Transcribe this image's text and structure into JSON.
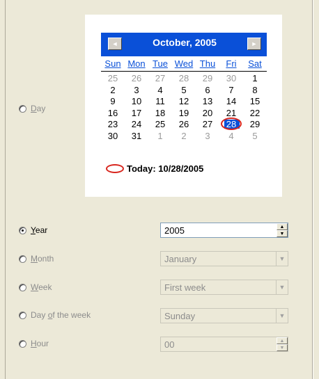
{
  "options": {
    "day": {
      "label": "Day",
      "accel": "D",
      "rest": "ay",
      "checked": false,
      "enabled": true
    },
    "year": {
      "label": "Year",
      "accel": "Y",
      "rest": "ear",
      "checked": true,
      "enabled": true
    },
    "month": {
      "label": "Month",
      "accel": "M",
      "rest": "onth",
      "checked": false,
      "enabled": false
    },
    "week": {
      "label": "Week",
      "accel": "W",
      "rest": "eek",
      "checked": false,
      "enabled": false
    },
    "day_of_week": {
      "label": "Day of the week",
      "pre": "Day ",
      "accel": "o",
      "rest": "f the week",
      "checked": false,
      "enabled": false
    },
    "hour": {
      "label": "Hour",
      "accel": "H",
      "rest": "our",
      "checked": false,
      "enabled": false
    }
  },
  "calendar": {
    "title": "October, 2005",
    "prev_glyph": "◄",
    "next_glyph": "►",
    "days_of_week": [
      "Sun",
      "Mon",
      "Tue",
      "Wed",
      "Thu",
      "Fri",
      "Sat"
    ],
    "weeks": [
      [
        "25",
        "26",
        "27",
        "28",
        "29",
        "30",
        "1"
      ],
      [
        "2",
        "3",
        "4",
        "5",
        "6",
        "7",
        "8"
      ],
      [
        "9",
        "10",
        "11",
        "12",
        "13",
        "14",
        "15"
      ],
      [
        "16",
        "17",
        "18",
        "19",
        "20",
        "21",
        "22"
      ],
      [
        "23",
        "24",
        "25",
        "26",
        "27",
        "28",
        "29"
      ],
      [
        "30",
        "31",
        "1",
        "2",
        "3",
        "4",
        "5"
      ]
    ],
    "selected_day": "28",
    "today_label": "Today: 10/28/2005"
  },
  "controls": {
    "year_value": "2005",
    "month_value": "January",
    "week_value": "First week",
    "day_of_week_value": "Sunday",
    "hour_value": "00"
  },
  "colors": {
    "accent": "#0a50d8",
    "today_circle": "#d8261e",
    "dialog_bg": "#ece9d8"
  }
}
